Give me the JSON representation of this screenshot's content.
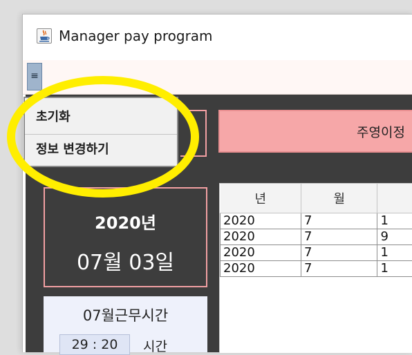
{
  "window": {
    "title": "Manager pay program",
    "app_icon": "java-cup-icon"
  },
  "menubar": {
    "toggle_glyph": "≡",
    "toggle_icon": "hamburger-menu-icon"
  },
  "popup_menu": {
    "items": [
      {
        "label": "초기화"
      },
      {
        "label": "정보 변경하기"
      }
    ]
  },
  "header": {
    "title": "주영이정"
  },
  "date_panel": {
    "year": "2020년",
    "day": "07월 03일"
  },
  "work_panel": {
    "title": "07월근무시간",
    "value": "29 : 20",
    "unit": "시간"
  },
  "table": {
    "columns": [
      "년",
      "월",
      ""
    ],
    "rows": [
      [
        "2020",
        "7",
        "1"
      ],
      [
        "2020",
        "7",
        "9"
      ],
      [
        "2020",
        "7",
        "1"
      ],
      [
        "2020",
        "7",
        "1"
      ]
    ]
  },
  "colors": {
    "highlight_ring": "#ffee00",
    "content_bg": "#3d3d3d",
    "header_pink": "#f6a7a8",
    "border_pink": "#f3a0a3",
    "menubar_bg": "#fff7f5",
    "toggle_blue": "#9fb4cc",
    "work_panel_bg": "#eef1fb"
  }
}
